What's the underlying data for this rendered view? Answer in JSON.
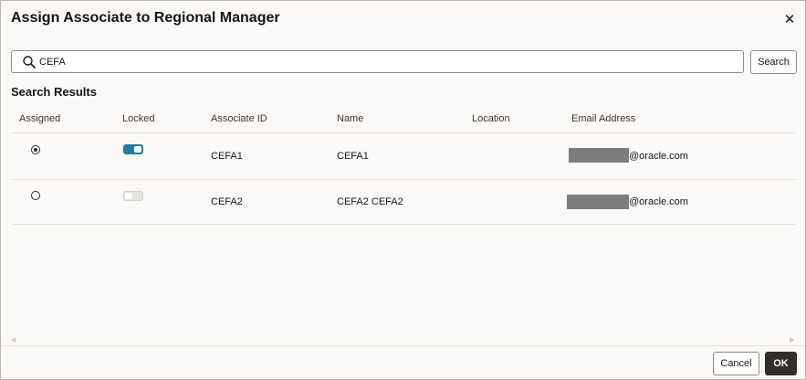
{
  "dialog": {
    "title": "Assign Associate to Regional Manager",
    "close_icon": "close-icon"
  },
  "search": {
    "value": "CEFA",
    "button_label": "Search",
    "icon": "search-icon"
  },
  "results": {
    "heading": "Search Results",
    "columns": [
      "Assigned",
      "Locked",
      "Associate ID",
      "Name",
      "Location",
      "Email Address"
    ],
    "rows": [
      {
        "assigned": true,
        "locked": true,
        "associate_id": "CEFA1",
        "name": "CEFA1",
        "location": "",
        "email_suffix": "@oracle.com"
      },
      {
        "assigned": false,
        "locked": false,
        "associate_id": "CEFA2",
        "name": "CEFA2 CEFA2",
        "location": "",
        "email_suffix": "@oracle.com"
      }
    ]
  },
  "footer": {
    "cancel_label": "Cancel",
    "ok_label": "OK"
  },
  "colors": {
    "toggle_on": "#227e9e",
    "primary_button": "#312d2a",
    "redaction": "#7d7d7d"
  }
}
